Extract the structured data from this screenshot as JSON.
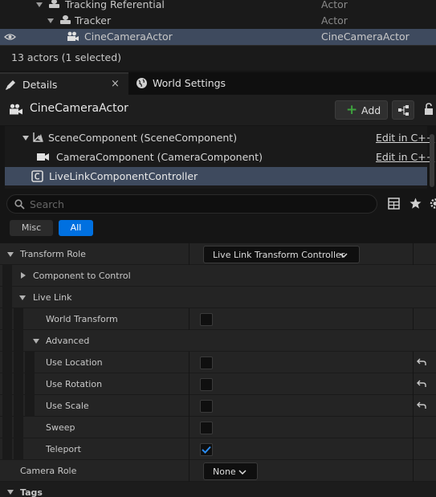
{
  "outliner": {
    "rows": [
      {
        "label": "Tracking Referential",
        "type": "Actor"
      },
      {
        "label": "Tracker",
        "type": "Actor"
      },
      {
        "label": "CineCameraActor",
        "type": "CineCameraActor"
      }
    ],
    "status": "13 actors (1 selected)"
  },
  "tabs": {
    "details": "Details",
    "world_settings": "World Settings",
    "close": "×"
  },
  "details": {
    "actor_name": "CineCameraActor",
    "add_label": "Add",
    "components": [
      {
        "label": "SceneComponent (SceneComponent)",
        "edit": "Edit in C++"
      },
      {
        "label": "CameraComponent (CameraComponent)",
        "edit": "Edit in C++"
      },
      {
        "label": "LiveLinkComponentController"
      }
    ],
    "search_placeholder": "Search",
    "filters": {
      "misc": "Misc",
      "all": "All"
    }
  },
  "properties": {
    "transform_role": {
      "label": "Transform Role",
      "value": "Live Link Transform Controller"
    },
    "component_to_control": "Component to Control",
    "live_link": "Live Link",
    "world_transform": "World Transform",
    "advanced": "Advanced",
    "use_location": "Use Location",
    "use_rotation": "Use Rotation",
    "use_scale": "Use Scale",
    "sweep": "Sweep",
    "teleport": {
      "label": "Teleport",
      "checked": true
    },
    "camera_role": {
      "label": "Camera Role",
      "value": "None"
    },
    "tags": "Tags"
  },
  "colors": {
    "accent": "#0070e0",
    "selection": "#3e4a5e",
    "add_plus": "#3ea33e"
  }
}
